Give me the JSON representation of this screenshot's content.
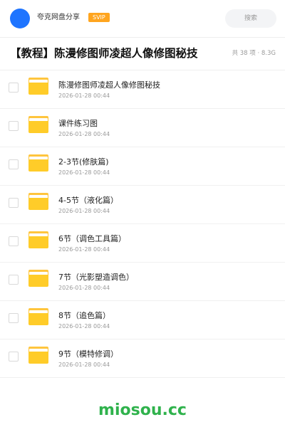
{
  "header": {
    "share_name": "夸克网盘分享",
    "badge": "SVIP",
    "search_placeholder": "搜索"
  },
  "folder": {
    "title": "【教程】陈漫修图师凌超人像修图秘技",
    "meta": "共 38 项 · 8.3G"
  },
  "files": [
    {
      "name": "陈漫修图师凌超人像修图秘技",
      "date": "2026-01-28 00:44"
    },
    {
      "name": "课件练习图",
      "date": "2026-01-28 00:44"
    },
    {
      "name": "2-3节(修肤篇)",
      "date": "2026-01-28 00:44"
    },
    {
      "name": "4-5节（液化篇）",
      "date": "2026-01-28 00:44"
    },
    {
      "name": "6节（调色工具篇）",
      "date": "2026-01-28 00:44"
    },
    {
      "name": "7节（光影塑造调色）",
      "date": "2026-01-28 00:44"
    },
    {
      "name": "8节（追色篇）",
      "date": "2026-01-28 00:44"
    },
    {
      "name": "9节（模特修调）",
      "date": "2026-01-28 00:44"
    }
  ],
  "watermark": "miosou.cc",
  "colors": {
    "avatar": "#1e74ff",
    "badge": "#ffa51f",
    "folder": "#ffcc29",
    "watermark": "#2fb24c"
  }
}
